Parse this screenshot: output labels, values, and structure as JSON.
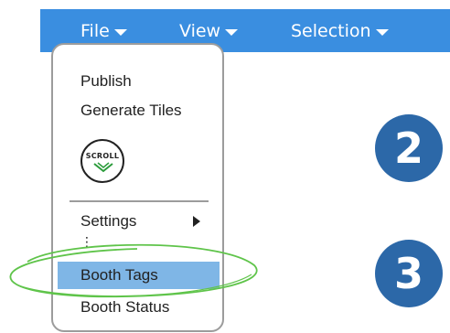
{
  "menubar": {
    "items": [
      {
        "label": "File"
      },
      {
        "label": "View"
      },
      {
        "label": "Selection"
      }
    ]
  },
  "file_menu": {
    "publish": "Publish",
    "generate_tiles": "Generate Tiles",
    "scroll_badge": "SCROLL",
    "settings": "Settings",
    "booth_tags": "Booth Tags",
    "booth_status": "Booth Status"
  },
  "steps": [
    "2",
    "3"
  ],
  "colors": {
    "menubar": "#3a8ee0",
    "highlight": "#7fb6e6",
    "step_badge": "#2c68a8",
    "annotation": "#5fc44a"
  }
}
